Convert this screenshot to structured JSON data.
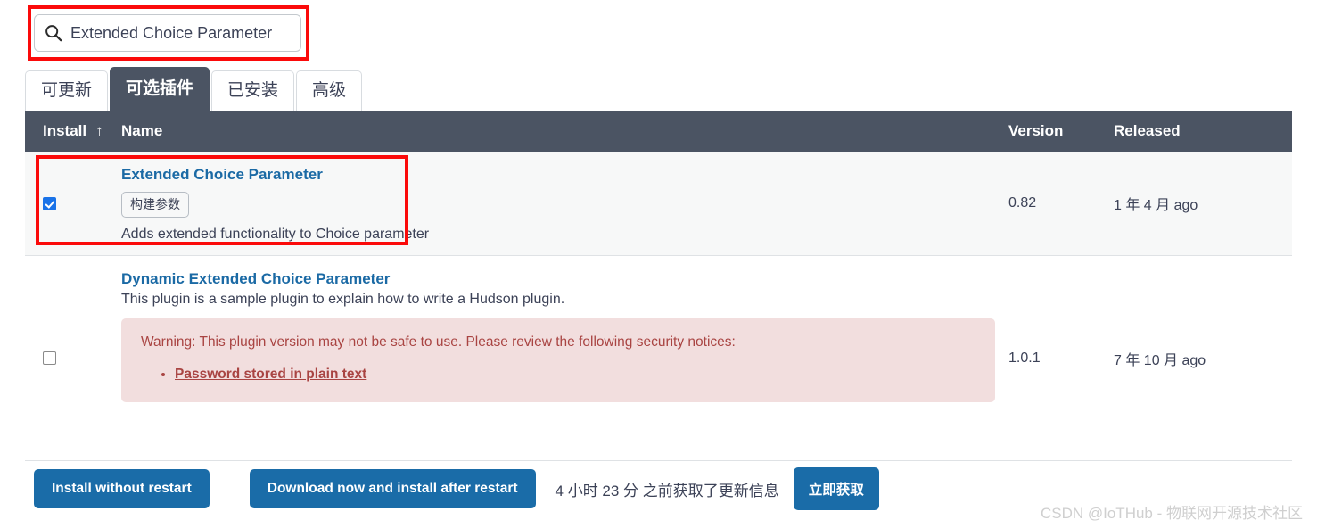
{
  "search": {
    "value": "Extended Choice Parameter",
    "placeholder": "",
    "icon": "search-icon"
  },
  "tabs": [
    {
      "label": "可更新",
      "active": false
    },
    {
      "label": "可选插件",
      "active": true
    },
    {
      "label": "已安装",
      "active": false
    },
    {
      "label": "高级",
      "active": false
    }
  ],
  "table": {
    "headers": {
      "install": "Install",
      "sort_arrow": "↑",
      "name": "Name",
      "version": "Version",
      "released": "Released"
    },
    "rows": [
      {
        "checked": true,
        "name": "Extended Choice Parameter",
        "tag": "构建参数",
        "description": "Adds extended functionality to Choice parameter",
        "version": "0.82",
        "released": "1 年 4 月 ago"
      },
      {
        "checked": false,
        "name": "Dynamic Extended Choice Parameter",
        "description": "This plugin is a sample plugin to explain how to write a Hudson plugin.",
        "warning": {
          "text": "Warning: This plugin version may not be safe to use. Please review the following security notices:",
          "notices": [
            "Password stored in plain text"
          ]
        },
        "version": "1.0.1",
        "released": "7 年 10 月 ago"
      }
    ]
  },
  "footer": {
    "install_without_restart": "Install without restart",
    "download_now_install_after_restart": "Download now and install after restart",
    "refresh_status": "4 小时 23 分 之前获取了更新信息",
    "refresh_button": "立即获取"
  },
  "watermark": "CSDN @IoTHub - 物联网开源技术社区",
  "colors": {
    "accent": "#1a6ca8",
    "link": "#1b6aa5",
    "header_bg": "#4b5463",
    "warning_bg": "#f2dede",
    "warning_text": "#a94442",
    "annotation": "#fb0a0a",
    "checkbox_checked": "#1a73e8"
  }
}
